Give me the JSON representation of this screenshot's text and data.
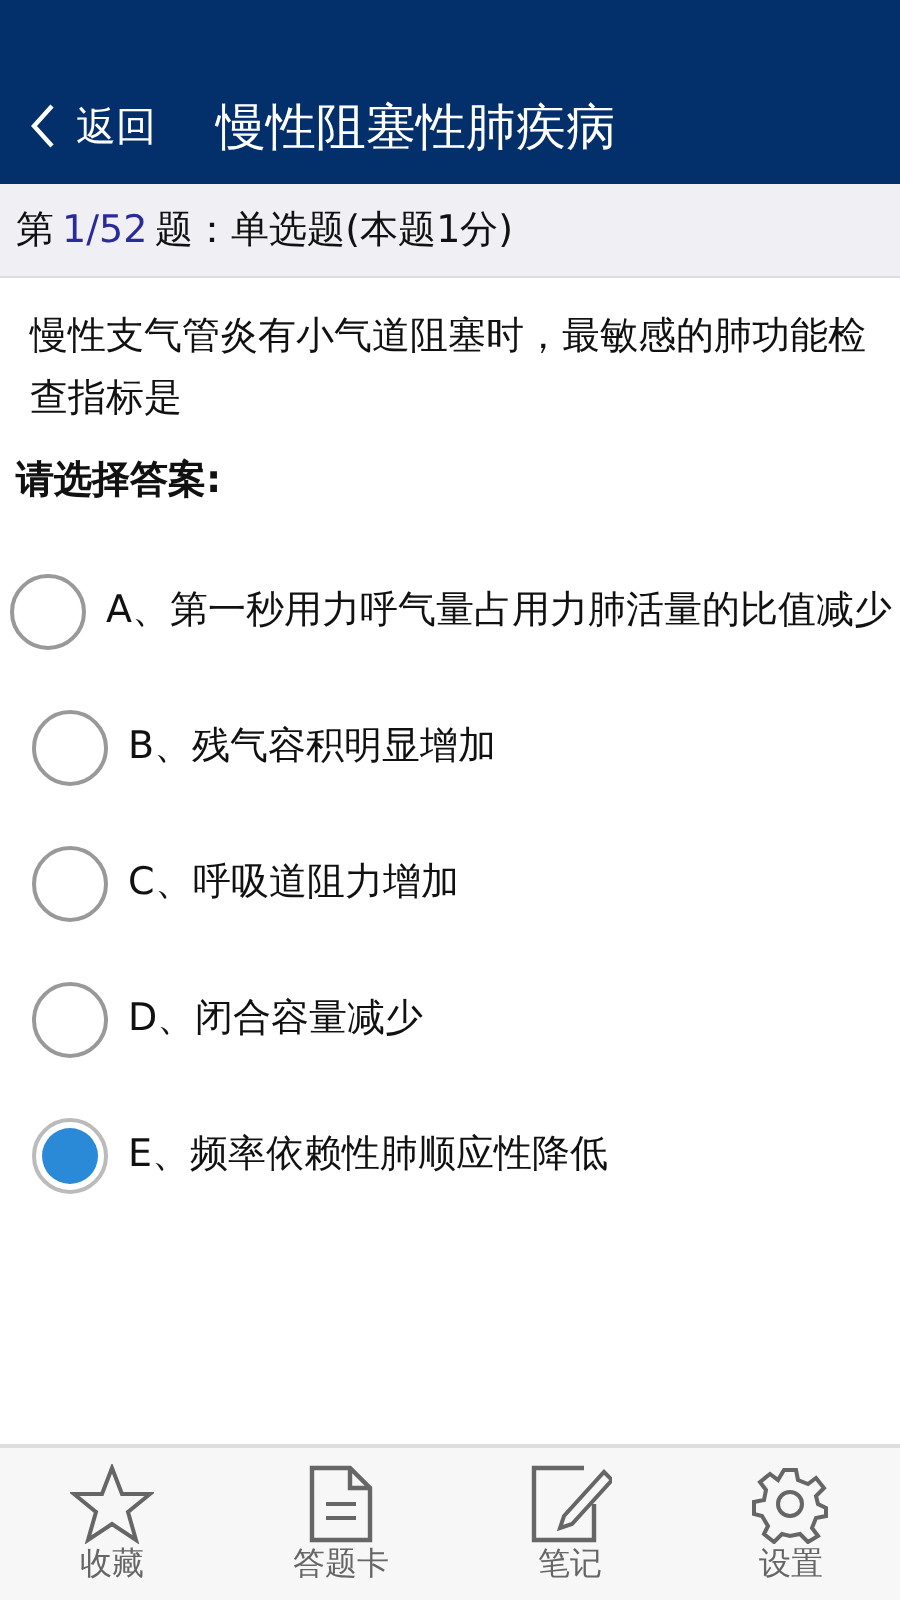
{
  "nav": {
    "back": "返回",
    "title": "慢性阻塞性肺疾病"
  },
  "header": {
    "prefix": "第",
    "number": "1/52",
    "suffix": "题：单选题(本题1分)"
  },
  "question": "慢性支气管炎有小气道阻塞时，最敏感的肺功能检查指标是",
  "prompt": "请选择答案:",
  "options": [
    {
      "label": "A、第一秒用力呼气量占用力肺活量的比值减少",
      "selected": false
    },
    {
      "label": "B、残气容积明显增加",
      "selected": false
    },
    {
      "label": "C、呼吸道阻力增加",
      "selected": false
    },
    {
      "label": "D、闭合容量减少",
      "selected": false
    },
    {
      "label": "E、频率依赖性肺顺应性降低",
      "selected": true
    }
  ],
  "tabs": [
    {
      "kind": "star",
      "label": "收藏"
    },
    {
      "kind": "card",
      "label": "答题卡"
    },
    {
      "kind": "note",
      "label": "笔记"
    },
    {
      "kind": "gear",
      "label": "设置"
    }
  ]
}
